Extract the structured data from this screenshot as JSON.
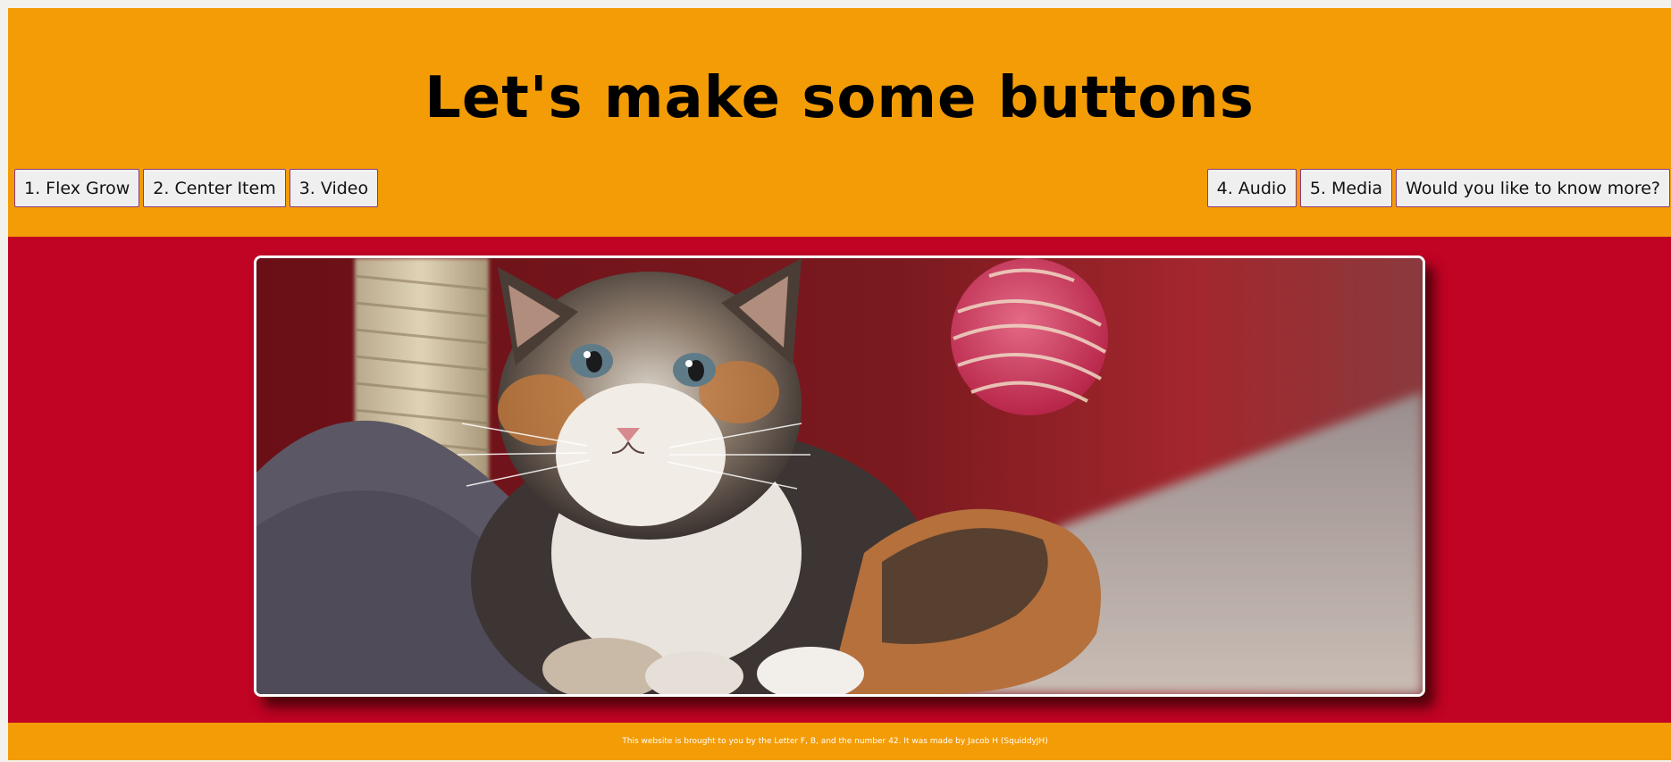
{
  "header": {
    "title": "Let's make some buttons"
  },
  "nav": {
    "left_buttons": [
      {
        "label": "1. Flex Grow"
      },
      {
        "label": "2. Center Item"
      },
      {
        "label": "3. Video"
      }
    ],
    "right_buttons": [
      {
        "label": "4. Audio"
      },
      {
        "label": "5. Media"
      },
      {
        "label": "Would you like to know more?"
      }
    ]
  },
  "hero": {
    "subject": "calico-kitten-photo"
  },
  "footer": {
    "text": "This website is brought to you by the Letter F, B, and the number 42. It was made by Jacob H (SquiddyJH)"
  },
  "colors": {
    "header_bg": "#f39c06",
    "main_bg": "#c10324",
    "footer_bg": "#f39c06",
    "button_bg": "#efefef",
    "button_border": "#8a3a7a"
  }
}
